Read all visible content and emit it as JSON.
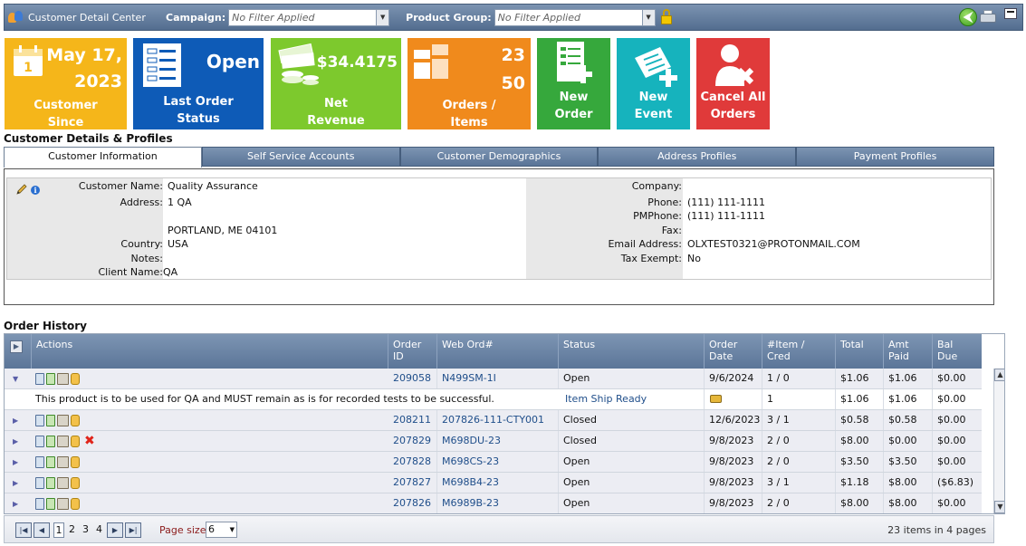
{
  "header": {
    "app_title": "Customer Detail Center",
    "campaign_label": "Campaign:",
    "campaign_value": "No Filter Applied",
    "product_group_label": "Product Group:",
    "product_group_value": "No Filter Applied"
  },
  "tiles": {
    "customer_since": {
      "line1": "May 17,",
      "line2": "2023",
      "label1": "Customer",
      "label2": "Since",
      "color": "#f5b61a"
    },
    "last_order": {
      "value": "Open",
      "label1": "Last Order",
      "label2": "Status",
      "color": "#0e5bb7"
    },
    "net_revenue": {
      "value": "$34.4175",
      "label1": "Net",
      "label2": "Revenue",
      "color": "#7dc92d"
    },
    "orders_items": {
      "orders": "23",
      "items": "50",
      "label1": "Orders /",
      "label2": "Items",
      "color": "#f08a1c"
    },
    "new_order": {
      "label1": "New",
      "label2": "Order",
      "color": "#36a83c"
    },
    "new_event": {
      "label1": "New",
      "label2": "Event",
      "color": "#16b3bd"
    },
    "cancel_orders": {
      "label1": "Cancel All",
      "label2": "Orders",
      "color": "#e03a3a"
    }
  },
  "profiles": {
    "title": "Customer Details & Profiles",
    "tabs": [
      "Customer Information",
      "Self Service Accounts",
      "Customer Demographics",
      "Address Profiles",
      "Payment Profiles"
    ],
    "left": {
      "customer_name_label": "Customer Name:",
      "customer_name": "Quality Assurance",
      "address_label": "Address:",
      "address_line1": "1 QA",
      "address_line2": "PORTLAND, ME 04101",
      "country_label": "Country:",
      "country": "USA",
      "notes_label": "Notes:",
      "notes": "",
      "client_name_label": "Client Name:",
      "client_name": "QA"
    },
    "right": {
      "company_label": "Company:",
      "company": "",
      "phone_label": "Phone:",
      "phone": "(111) 111-1111",
      "pmphone_label": "PMPhone:",
      "pmphone": "(111) 111-1111",
      "fax_label": "Fax:",
      "fax": "",
      "email_label": "Email Address:",
      "email": "OLXTEST0321@PROTONMAIL.COM",
      "tax_label": "Tax Exempt:",
      "tax": "No"
    }
  },
  "orders": {
    "title": "Order History",
    "headers": {
      "actions": "Actions",
      "order_id_1": "Order",
      "order_id_2": "ID",
      "web_ord": "Web Ord#",
      "status": "Status",
      "order_date_1": "Order",
      "order_date_2": "Date",
      "item_cred_1": "#Item /",
      "item_cred_2": "Cred",
      "total": "Total",
      "amt_paid_1": "Amt",
      "amt_paid_2": "Paid",
      "bal_due_1": "Bal",
      "bal_due_2": "Due"
    },
    "rows": [
      {
        "order_id": "209058",
        "web": "N499SM-1I",
        "status": "Open",
        "date": "9/6/2024",
        "items": "1 / 0",
        "total": "$1.06",
        "paid": "$1.06",
        "bal": "$0.00"
      },
      {
        "order_id": "208211",
        "web": "207826-111-CTY001",
        "status": "Closed",
        "date": "12/6/2023",
        "items": "3 / 1",
        "total": "$0.58",
        "paid": "$0.58",
        "bal": "$0.00"
      },
      {
        "order_id": "207829",
        "web": "M698DU-23",
        "status": "Closed",
        "date": "9/8/2023",
        "items": "2 / 0",
        "total": "$8.00",
        "paid": "$0.00",
        "bal": "$0.00"
      },
      {
        "order_id": "207828",
        "web": "M698CS-23",
        "status": "Open",
        "date": "9/8/2023",
        "items": "2 / 0",
        "total": "$3.50",
        "paid": "$3.50",
        "bal": "$0.00"
      },
      {
        "order_id": "207827",
        "web": "M698B4-23",
        "status": "Open",
        "date": "9/8/2023",
        "items": "3 / 1",
        "total": "$1.18",
        "paid": "$8.00",
        "bal": "($6.83)"
      },
      {
        "order_id": "207826",
        "web": "M6989B-23",
        "status": "Open",
        "date": "9/8/2023",
        "items": "2 / 0",
        "total": "$8.00",
        "paid": "$8.00",
        "bal": "$0.00"
      }
    ],
    "detail": {
      "note": "This product is to be used for QA and MUST remain as is for recorded tests to be successful.",
      "status": "Item Ship Ready",
      "qty": "1",
      "total": "$1.06",
      "paid": "$1.06",
      "bal": "$0.00"
    }
  },
  "pager": {
    "pages": [
      "1",
      "2",
      "3",
      "4"
    ],
    "page_size_label": "Page size:",
    "page_size": "6",
    "items_count": "23",
    "items_text": "items in",
    "page_count": "4",
    "pages_text": "pages"
  }
}
